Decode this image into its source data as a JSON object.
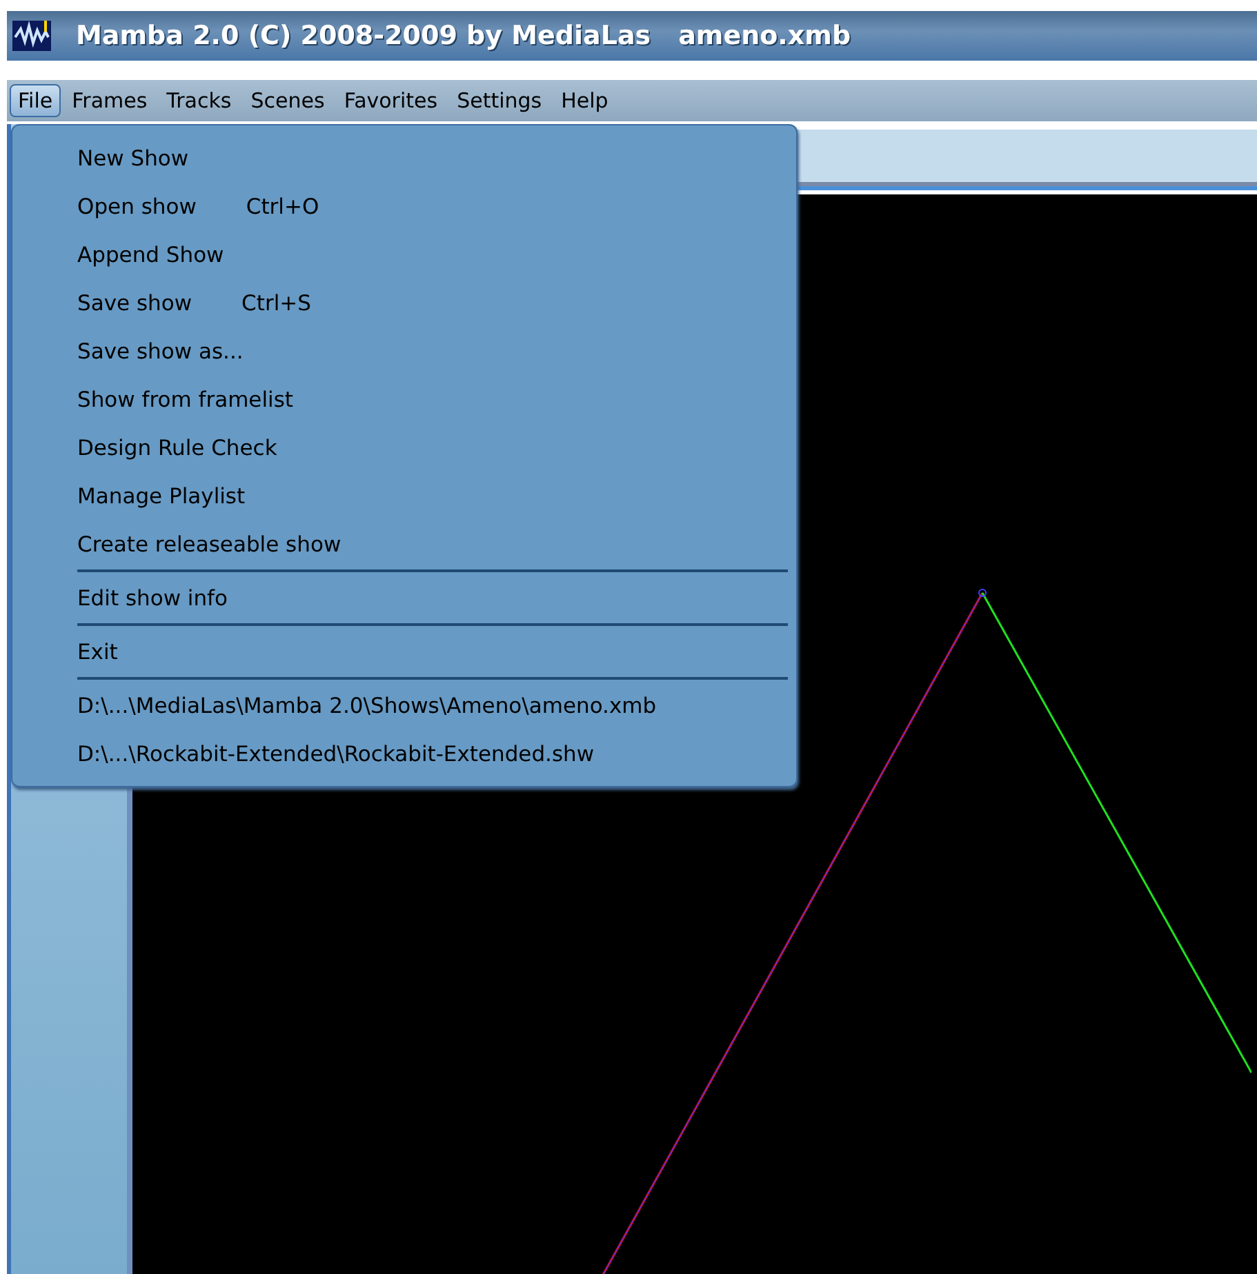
{
  "window": {
    "title": "Mamba 2.0 (C) 2008-2009 by MediaLas",
    "document": "ameno.xmb"
  },
  "menu_bar": [
    {
      "label": "File",
      "selected": true
    },
    {
      "label": "Frames",
      "selected": false
    },
    {
      "label": "Tracks",
      "selected": false
    },
    {
      "label": "Scenes",
      "selected": false
    },
    {
      "label": "Favorites",
      "selected": false
    },
    {
      "label": "Settings",
      "selected": false
    },
    {
      "label": "Help",
      "selected": false
    }
  ],
  "file_menu": [
    {
      "kind": "item",
      "label": "New Show"
    },
    {
      "kind": "item",
      "label": "Open show",
      "shortcut": "Ctrl+O"
    },
    {
      "kind": "item",
      "label": "Append Show"
    },
    {
      "kind": "item",
      "label": "Save show",
      "shortcut": "Ctrl+S"
    },
    {
      "kind": "item",
      "label": "Save show as..."
    },
    {
      "kind": "item",
      "label": "Show from framelist"
    },
    {
      "kind": "item",
      "label": "Design Rule Check"
    },
    {
      "kind": "item",
      "label": "Manage Playlist"
    },
    {
      "kind": "item",
      "label": "Create releaseable show"
    },
    {
      "kind": "separator"
    },
    {
      "kind": "item",
      "label": "Edit show info"
    },
    {
      "kind": "separator"
    },
    {
      "kind": "item",
      "label": "Exit"
    },
    {
      "kind": "separator"
    },
    {
      "kind": "item",
      "label": "D:\\...\\MediaLas\\Mamba 2.0\\Shows\\Ameno\\ameno.xmb"
    },
    {
      "kind": "item",
      "label": "D:\\...\\Rockabit-Extended\\Rockabit-Extended.shw"
    }
  ]
}
